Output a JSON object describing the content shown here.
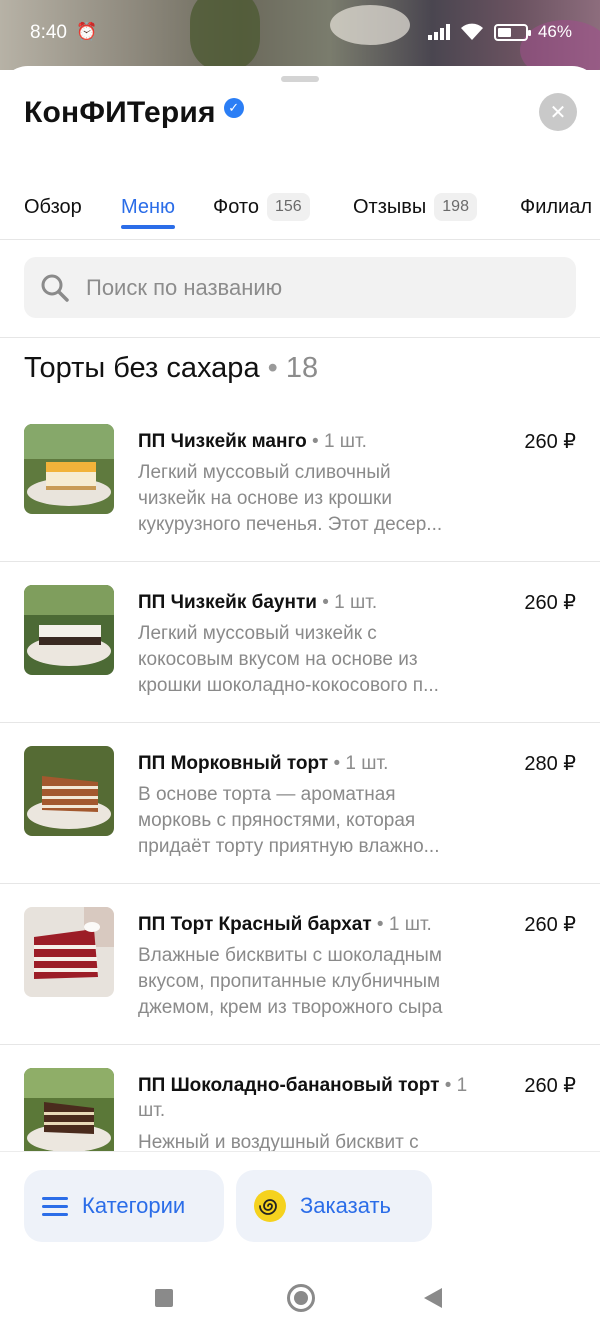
{
  "status_bar": {
    "time": "8:40",
    "battery": "46%"
  },
  "header": {
    "title": "КонФИТерия"
  },
  "tabs": [
    {
      "label": "Обзор",
      "count": ""
    },
    {
      "label": "Меню",
      "count": ""
    },
    {
      "label": "Фото",
      "count": "156"
    },
    {
      "label": "Отзывы",
      "count": "198"
    },
    {
      "label": "Филиал",
      "count": ""
    }
  ],
  "search": {
    "placeholder": "Поиск по названию"
  },
  "section": {
    "title": "Торты без сахара",
    "separator": "•",
    "count": "18"
  },
  "items": [
    {
      "name": "ПП Чизкейк манго",
      "qty": "1 шт.",
      "price": "260 ₽",
      "desc1": "Легкий муссовый сливочный",
      "desc2": "чизкейк на основе из крошки",
      "desc3": "кукурузного печенья. Этот десер..."
    },
    {
      "name": "ПП Чизкейк баунти",
      "qty": "1 шт.",
      "price": "260 ₽",
      "desc1": "Легкий муссовый чизкейк с",
      "desc2": "кокосовым вкусом на основе из",
      "desc3": "крошки шоколадно-кокосового п..."
    },
    {
      "name": "ПП Морковный торт",
      "qty": "1 шт.",
      "price": "280 ₽",
      "desc1": "В основе торта — ароматная",
      "desc2": "морковь с пряностями, которая",
      "desc3": "придаёт торту приятную влажно..."
    },
    {
      "name": "ПП Торт Красный бархат",
      "qty": "1 шт.",
      "price": "260 ₽",
      "desc1": "Влажные бисквиты с шоколадным",
      "desc2": "вкусом, пропитанные клубничным",
      "desc3": "джемом, крем из творожного сыра"
    },
    {
      "name": "ПП Шоколадно-банановый торт",
      "qty": "1 шт.",
      "price": "260 ₽",
      "desc1": "Нежный и воздушный бисквит с"
    }
  ],
  "actions": {
    "categories": "Категории",
    "order": "Заказать"
  }
}
